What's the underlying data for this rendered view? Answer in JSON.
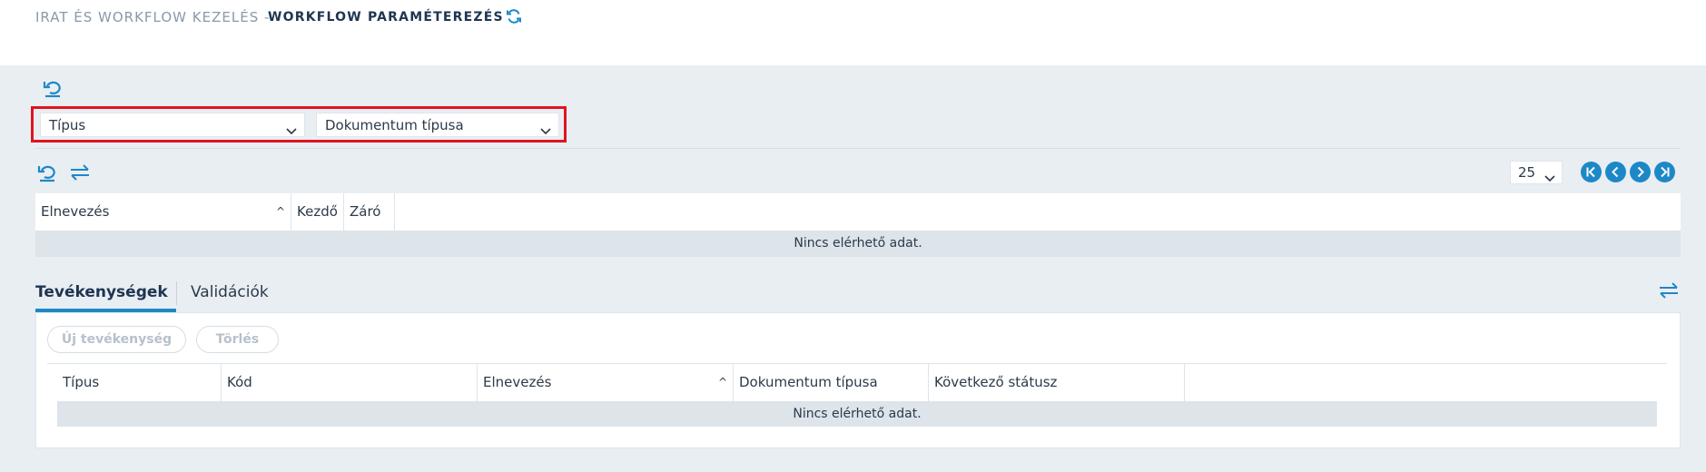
{
  "header": {
    "breadcrumb_parent": "IRAT ÉS WORKFLOW KEZELÉS -",
    "breadcrumb_current": "WORKFLOW PARAMÉTEREZÉS"
  },
  "filters": {
    "type_select": "Típus",
    "doc_type_select": "Dokumentum típusa"
  },
  "pager": {
    "page_size": "25"
  },
  "grid1": {
    "columns": [
      "Elnevezés",
      "Kezdő",
      "Záró"
    ],
    "empty_text": "Nincs elérhető adat."
  },
  "tabs": {
    "active": "Tevékenységek",
    "inactive": "Validációk"
  },
  "activities": {
    "new_button": "Új tevékenység",
    "delete_button": "Törlés",
    "columns": [
      "Típus",
      "Kód",
      "Elnevezés",
      "Dokumentum típusa",
      "Következő státusz"
    ],
    "empty_text": "Nincs elérhető adat."
  },
  "colors": {
    "accent": "#1e88c7",
    "highlight_border": "#e0141f",
    "background": "#e9eef3",
    "header_dark": "#1e3551"
  },
  "icons": [
    "refresh-icon",
    "reset-icon",
    "swap-columns-icon",
    "chevron-down-icon",
    "first-page-icon",
    "prev-page-icon",
    "next-page-icon",
    "last-page-icon"
  ]
}
